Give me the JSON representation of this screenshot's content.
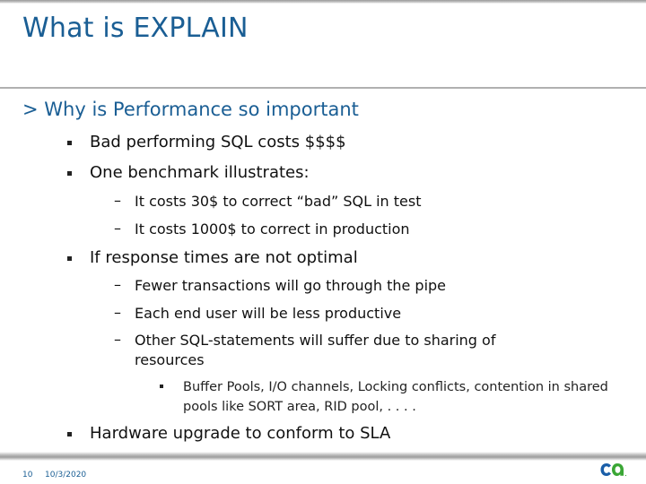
{
  "slide": {
    "title": "What is EXPLAIN",
    "heading": "> Why is Performance so important",
    "bullets": [
      {
        "text": "Bad performing SQL costs $$$$"
      },
      {
        "text": "One benchmark illustrates:",
        "sub": [
          "It costs 30$ to correct “bad” SQL in test",
          "It costs 1000$ to correct in production"
        ]
      },
      {
        "text": "If response times are not optimal",
        "sub": [
          "Fewer transactions will go through the pipe",
          "Each end user will be less productive",
          "Other SQL-statements will suffer due to sharing of resources"
        ],
        "subsub": "Buffer Pools, I/O channels, Locking conflicts, contention in shared pools like SORT area, RID pool, . . . ."
      },
      {
        "text": "Hardware upgrade to conform to SLA"
      }
    ],
    "dash_glyph": "–"
  },
  "footer": {
    "page_number": "10",
    "date": "10/3/2020",
    "logo": "ca-logo"
  },
  "colors": {
    "title": "#1a5e94",
    "logo_blue": "#1a5ea8",
    "logo_green": "#3aa635"
  }
}
